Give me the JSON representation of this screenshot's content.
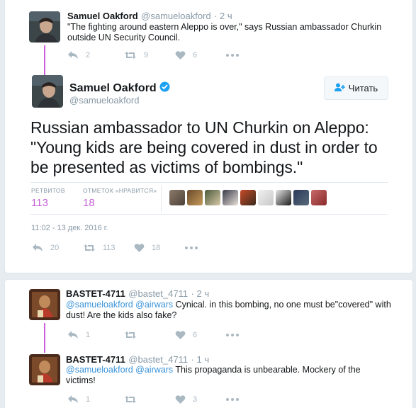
{
  "parent_tweet": {
    "name": "Samuel Oakford",
    "handle": "@samueloakford",
    "time": "· 2 ч",
    "text": "\"The fighting around eastern Aleppo is over,\" says Russian ambassador Churkin outside UN Security Council.",
    "replies": "2",
    "retweets": "9",
    "likes": "6"
  },
  "main_tweet": {
    "name": "Samuel Oakford",
    "handle": "@samueloakford",
    "follow_label": "Читать",
    "text": "Russian ambassador to UN Churkin on Aleppo: \"Young kids are being covered in dust in order to be presented as victims of bombings.\"",
    "retweets_label": "РЕТВИТОВ",
    "retweets_count": "113",
    "likes_label": "ОТМЕТОК «НРАВИТСЯ»",
    "likes_count": "18",
    "timestamp": "11:02 - 13 дек. 2016 г.",
    "replies": "20",
    "retweets": "113",
    "likes": "18"
  },
  "replies": [
    {
      "name": "BASTET-4711",
      "handle": "@bastet_4711",
      "time": "· 2 ч",
      "mentions": "@samueloakford @airwars",
      "text": " Cynical. in this bombing, no one must be\"covered\" with dust! Are the kids also fake?",
      "replies": "1",
      "retweets": "",
      "likes": "6"
    },
    {
      "name": "BASTET-4711",
      "handle": "@bastet_4711",
      "time": "· 1 ч",
      "mentions": "@samueloakford @airwars",
      "text": " This propaganda is unbearable. Mockery of the victims!",
      "replies": "1",
      "retweets": "",
      "likes": "3"
    }
  ],
  "colors": {
    "accent": "#c862d8",
    "link": "#3b94d9",
    "muted": "#8899a6",
    "verified": "#1da1f2"
  },
  "icons": [
    "reply-icon",
    "retweet-icon",
    "like-icon",
    "more-icon",
    "verified-icon",
    "follow-user-icon"
  ]
}
